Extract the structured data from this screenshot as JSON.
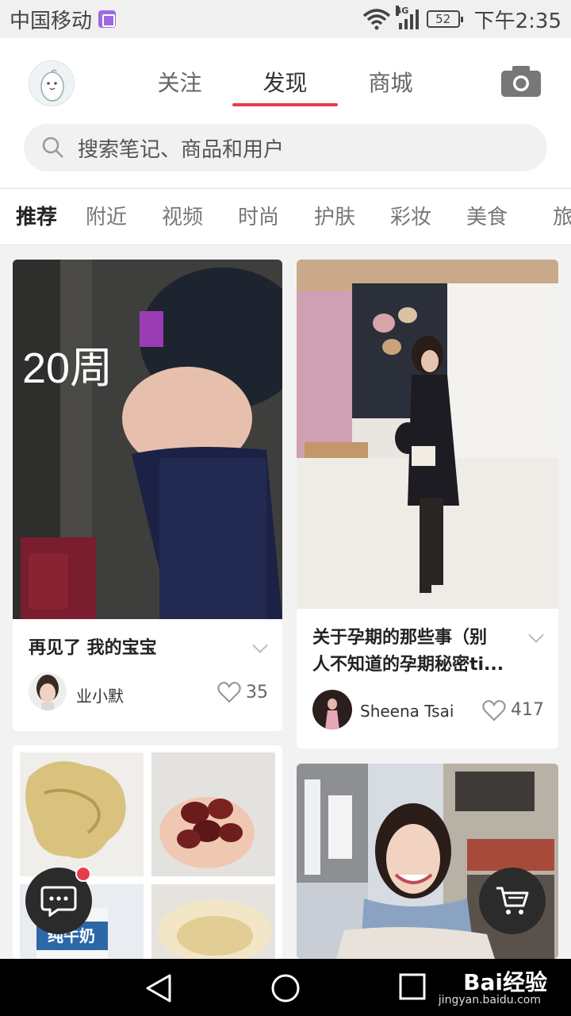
{
  "status": {
    "carrier": "中国移动",
    "network": "4G",
    "battery": "52",
    "time": "下午2:35"
  },
  "header": {
    "tabs": [
      "关注",
      "发现",
      "商城"
    ],
    "active_tab": "发现"
  },
  "search": {
    "placeholder": "搜索笔记、商品和用户"
  },
  "categories": [
    "推荐",
    "附近",
    "视频",
    "时尚",
    "护肤",
    "彩妆",
    "美食",
    "旅"
  ],
  "feed": {
    "card1": {
      "overlay_text": "20周",
      "title": "再见了 我的宝宝",
      "user": "业小默",
      "likes": "35"
    },
    "card2": {
      "title_line1": "关于孕期的那些事（别",
      "title_line2": "人不知道的孕期秘密ti...",
      "user": "Sheena Tsai",
      "likes": "417"
    },
    "card3": {
      "milk_label": "纯牛奶"
    }
  },
  "watermark": {
    "brand": "Bai经验",
    "url": "jingyan.baidu.com"
  },
  "colors": {
    "accent": "#e83c4c",
    "fab": "#2b2b2b"
  }
}
